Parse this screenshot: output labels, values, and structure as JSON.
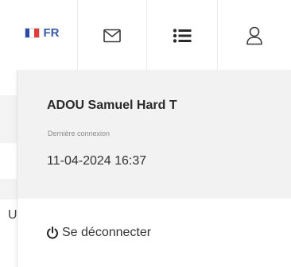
{
  "topbar": {
    "language": {
      "code": "FR",
      "flag_colors": [
        "#2b4aa8",
        "#ffffff",
        "#e23b3b"
      ]
    },
    "icons": [
      "mail-icon",
      "list-icon",
      "user-icon"
    ]
  },
  "dropdown": {
    "user_name": "ADOU Samuel Hard T",
    "last_login_label": "Dernière connexion",
    "last_login_value": "11-04-2024 16:37",
    "logout_label": "Se déconnecter"
  },
  "background": {
    "partial_letter": "U"
  },
  "colors": {
    "accent": "#3a5aa5",
    "panel_bg": "#f2f2f2",
    "border": "#ececec"
  }
}
